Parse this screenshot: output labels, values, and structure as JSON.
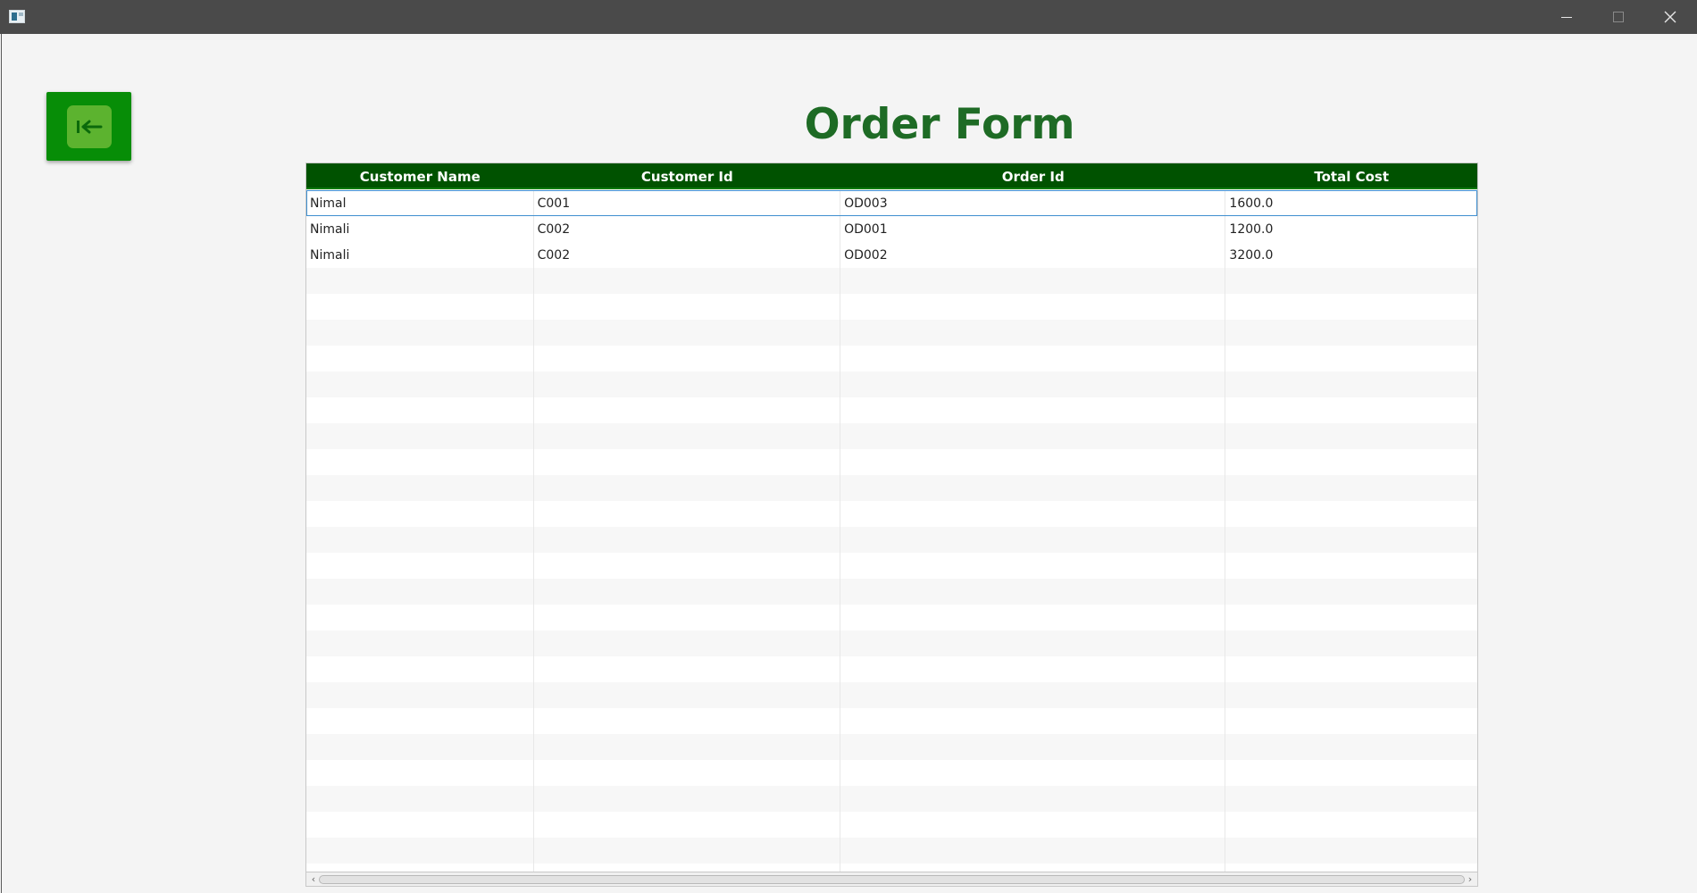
{
  "window": {
    "icon": "app-window-icon",
    "controls": [
      "minimize-icon",
      "maximize-icon",
      "close-icon"
    ]
  },
  "page": {
    "title": "Order Form",
    "back_icon": "arrow-left-to-bar-icon"
  },
  "table": {
    "columns": [
      "Customer Name",
      "Customer Id",
      "Order Id",
      "Total Cost"
    ],
    "rows": [
      {
        "customer_name": "Nimal",
        "customer_id": "C001",
        "order_id": "OD003",
        "total_cost": "1600.0"
      },
      {
        "customer_name": "Nimali",
        "customer_id": "C002",
        "order_id": "OD001",
        "total_cost": "1200.0"
      },
      {
        "customer_name": "Nimali",
        "customer_id": "C002",
        "order_id": "OD002",
        "total_cost": "3200.0"
      }
    ]
  },
  "colors": {
    "header_bg": "#005200",
    "title": "#1e6b25",
    "back_button": "#078d07",
    "back_button_inner": "#5cb32f"
  }
}
